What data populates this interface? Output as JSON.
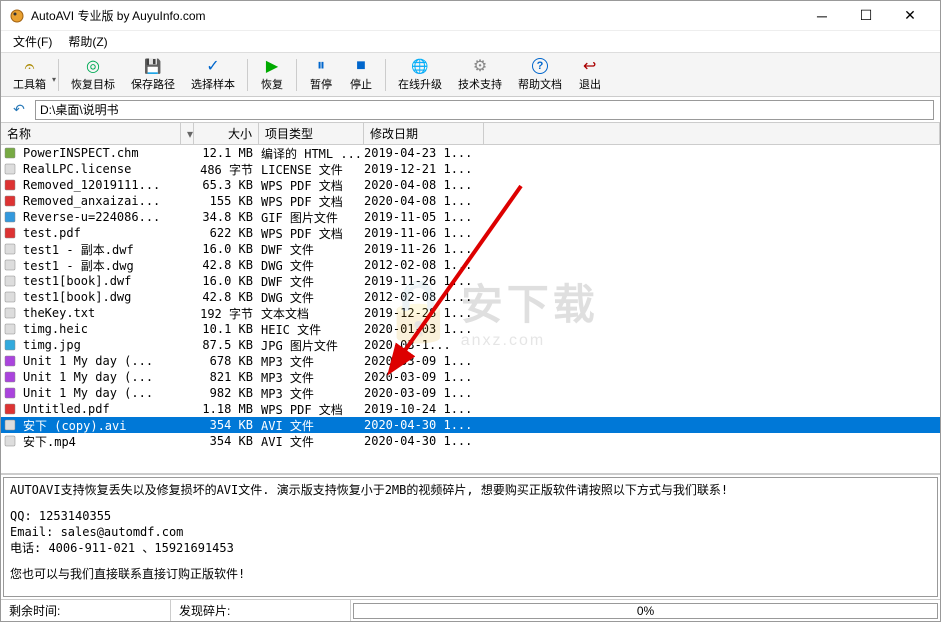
{
  "window_title": "AutoAVI 专业版 by AuyuInfo.com",
  "menubar": {
    "file": "文件(F)",
    "help": "帮助(Z)"
  },
  "toolbar": {
    "toolbox": "工具箱",
    "recover_target": "恢复目标",
    "save_path": "保存路径",
    "select_sample": "选择样本",
    "recover": "恢复",
    "pause": "暂停",
    "stop": "停止",
    "online_upgrade": "在线升级",
    "tech_support": "技术支持",
    "help_doc": "帮助文档",
    "exit": "退出"
  },
  "path_value": "D:\\桌面\\说明书",
  "columns": {
    "name": "名称",
    "size": "大小",
    "type": "项目类型",
    "date": "修改日期"
  },
  "files": [
    {
      "icon": "chm",
      "name": "PowerINSPECT.chm",
      "size": "12.1 MB",
      "type": "编译的 HTML ...",
      "date": "2019-04-23 1..."
    },
    {
      "icon": "lic",
      "name": "RealLPC.license",
      "size": "486 字节",
      "type": "LICENSE 文件",
      "date": "2019-12-21 1..."
    },
    {
      "icon": "pdf",
      "name": "Removed_12019111...",
      "size": "65.3 KB",
      "type": "WPS PDF 文档",
      "date": "2020-04-08 1..."
    },
    {
      "icon": "pdf",
      "name": "Removed_anxaizai...",
      "size": "155 KB",
      "type": "WPS PDF 文档",
      "date": "2020-04-08 1..."
    },
    {
      "icon": "gif",
      "name": "Reverse-u=224086...",
      "size": "34.8 KB",
      "type": "GIF 图片文件",
      "date": "2019-11-05 1..."
    },
    {
      "icon": "pdf",
      "name": "test.pdf",
      "size": "622 KB",
      "type": "WPS PDF 文档",
      "date": "2019-11-06 1..."
    },
    {
      "icon": "dwf",
      "name": "test1 - 副本.dwf",
      "size": "16.0 KB",
      "type": "DWF 文件",
      "date": "2019-11-26 1..."
    },
    {
      "icon": "dwg",
      "name": "test1 - 副本.dwg",
      "size": "42.8 KB",
      "type": "DWG 文件",
      "date": "2012-02-08 1..."
    },
    {
      "icon": "dwf",
      "name": "test1[book].dwf",
      "size": "16.0 KB",
      "type": "DWF 文件",
      "date": "2019-11-26 1..."
    },
    {
      "icon": "dwg",
      "name": "test1[book].dwg",
      "size": "42.8 KB",
      "type": "DWG 文件",
      "date": "2012-02-08 1..."
    },
    {
      "icon": "txt",
      "name": "theKey.txt",
      "size": "192 字节",
      "type": "文本文档",
      "date": "2019-12-28 1..."
    },
    {
      "icon": "heic",
      "name": "timg.heic",
      "size": "10.1 KB",
      "type": "HEIC 文件",
      "date": "2020-01-03 1..."
    },
    {
      "icon": "jpg",
      "name": "timg.jpg",
      "size": "87.5 KB",
      "type": "JPG 图片文件",
      "date": "2020-03-1..."
    },
    {
      "icon": "mp3",
      "name": "Unit 1 My day (...",
      "size": "678 KB",
      "type": "MP3 文件",
      "date": "2020-03-09 1..."
    },
    {
      "icon": "mp3",
      "name": "Unit 1 My day (...",
      "size": "821 KB",
      "type": "MP3 文件",
      "date": "2020-03-09 1..."
    },
    {
      "icon": "mp3",
      "name": "Unit 1 My day (...",
      "size": "982 KB",
      "type": "MP3 文件",
      "date": "2020-03-09 1..."
    },
    {
      "icon": "pdf",
      "name": "Untitled.pdf",
      "size": "1.18 MB",
      "type": "WPS PDF 文档",
      "date": "2019-10-24 1..."
    },
    {
      "icon": "avi",
      "name": "安下 (copy).avi",
      "size": "354 KB",
      "type": "AVI 文件",
      "date": "2020-04-30 1...",
      "selected": true
    },
    {
      "icon": "mp4",
      "name": "安下.mp4",
      "size": "354 KB",
      "type": "AVI 文件",
      "date": "2020-04-30 1..."
    }
  ],
  "info": {
    "line1": "AUTOAVI支持恢复丢失以及修复损坏的AVI文件. 演示版支持恢复小于2MB的视频碎片, 想要购买正版软件请按照以下方式与我们联系!",
    "qq": "QQ: 1253140355",
    "email": "Email: sales@automdf.com",
    "phone": "电话: 4006-911-021 、15921691453",
    "line2": "您也可以与我们直接联系直接订购正版软件!"
  },
  "status": {
    "remain_label": "剩余时间:",
    "fragments_label": "发现碎片:",
    "progress": "0%"
  },
  "watermark": {
    "cn": "安下载",
    "en": "anxz.com"
  }
}
